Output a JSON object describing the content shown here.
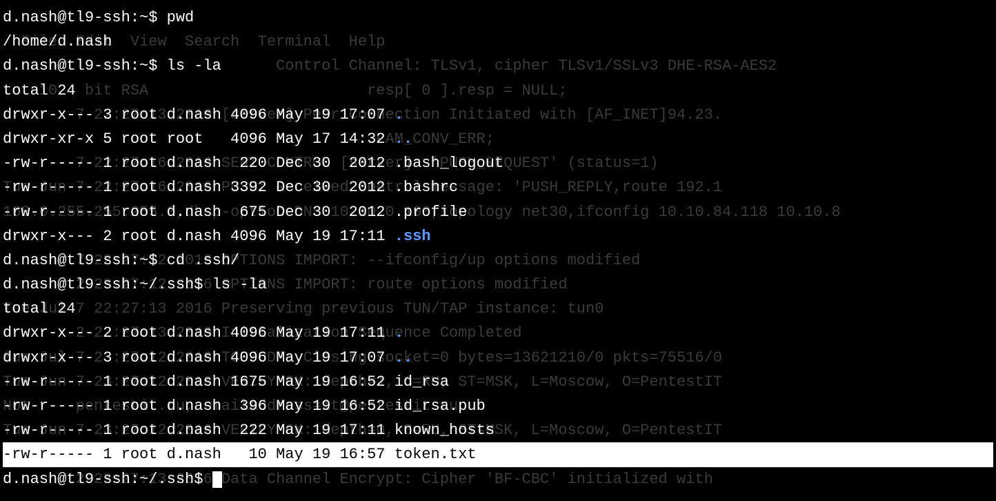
{
  "bg_lines": [
    "",
    "  File  Edit  View  Search  Terminal  Help",
    "                              Control Channel: TLSv1, cipher TLSv1/SSLv3 DHE-RSA-AES2",
    "    1024 bit RSA                        resp[ 0 ].resp = NULL;",
    "        7 22:27:13 2016 [server] Peer Connection Initiated with [AF_INET]94.23.",
    "                                         PAM_CONV_ERR;",
    "        7 22:27:16 2016 SENT CONTROL [server]: 'PUSH_REQUEST' (status=1)",
    "Tue Jun 7 22:27:16 2016 PUSH: Received control message: 'PUSH_REPLY,route 192.1",
    "168.0.255.255.255.0,dhcp-option DNS 10.10.0.100,topology net30,ifconfig 10.10.84.118 10.10.8",
    "",
    "        7 22:27:12 2016 OPTIONS IMPORT: --ifconfig/up options modified",
    "        2 23:27:12 2016 OPTIONS IMPORT: route options modified",
    "Tue Jul 7 22:27:13 2016 Preserving previous TUN/TAP instance: tun0",
    "        2 22:27:13 2016 Initialization Sequence Completed",
    "Sun Jul 7 23:27:12 2016 TCP/UDP: Closing socket=0 bytes=13621210/0 pkts=75516/0",
    "Tue Jun 7 23:27:12 2016 VERIFY OK: depth=1, C=RU, ST=MSK, L=Moscow, O=PentestIT",
    "Not     pentestit.ru, emailAddress=it@pentestit.ru",
    "Tue Jun 7 23:27:12 2016 VERIFY OK: depth=0, C=RU, ST=MSK, L=Moscow, O=PentestIT",
    "",
    "        2 23:27:13 2016 Data Channel Encrypt: Cipher 'BF-CBC' initialized with"
  ],
  "lines": [
    {
      "type": "prompt",
      "prompt": "d.nash@tl9-ssh:~$ ",
      "cmd": "pwd"
    },
    {
      "type": "output",
      "text": "/home/d.nash"
    },
    {
      "type": "prompt",
      "prompt": "d.nash@tl9-ssh:~$ ",
      "cmd": "ls -la"
    },
    {
      "type": "output",
      "text": "total 24"
    },
    {
      "type": "ls",
      "perms": "drwxr-x--- 3 root d.nash 4096 May 19 17:07 ",
      "name": ".",
      "dir": true
    },
    {
      "type": "ls",
      "perms": "drwxr-xr-x 5 root root   4096 May 17 14:32 ",
      "name": "..",
      "dir": true
    },
    {
      "type": "ls",
      "perms": "-rw-r----- 1 root d.nash  220 Dec 30  2012 ",
      "name": ".bash_logout",
      "dir": false
    },
    {
      "type": "ls",
      "perms": "-rw-r----- 1 root d.nash 3392 Dec 30  2012 ",
      "name": ".bashrc",
      "dir": false
    },
    {
      "type": "ls",
      "perms": "-rw-r----- 1 root d.nash  675 Dec 30  2012 ",
      "name": ".profile",
      "dir": false
    },
    {
      "type": "ls",
      "perms": "drwxr-x--- 2 root d.nash 4096 May 19 17:11 ",
      "name": ".ssh",
      "dir": true
    },
    {
      "type": "prompt",
      "prompt": "d.nash@tl9-ssh:~$ ",
      "cmd": "cd .ssh/"
    },
    {
      "type": "prompt",
      "prompt": "d.nash@tl9-ssh:~/.ssh$ ",
      "cmd": "ls -la"
    },
    {
      "type": "output",
      "text": "total 24"
    },
    {
      "type": "ls",
      "perms": "drwxr-x--- 2 root d.nash 4096 May 19 17:11 ",
      "name": ".",
      "dir": true
    },
    {
      "type": "ls",
      "perms": "drwxr-x--- 3 root d.nash 4096 May 19 17:07 ",
      "name": "..",
      "dir": true
    },
    {
      "type": "ls",
      "perms": "-rw-r----- 1 root d.nash 1675 May 19 16:52 ",
      "name": "id_rsa",
      "dir": false
    },
    {
      "type": "ls",
      "perms": "-rw-r----- 1 root d.nash  396 May 19 16:52 ",
      "name": "id_rsa.pub",
      "dir": false
    },
    {
      "type": "ls",
      "perms": "-rw-r----- 1 root d.nash  222 May 19 17:11 ",
      "name": "known_hosts",
      "dir": false
    },
    {
      "type": "ls-highlight",
      "perms": "-rw-r----- 1 root d.nash   10 May 19 16:57 ",
      "name": "token.txt",
      "dir": false
    },
    {
      "type": "prompt-cursor",
      "prompt": "d.nash@tl9-ssh:~/.ssh$ ",
      "cmd": ""
    }
  ]
}
